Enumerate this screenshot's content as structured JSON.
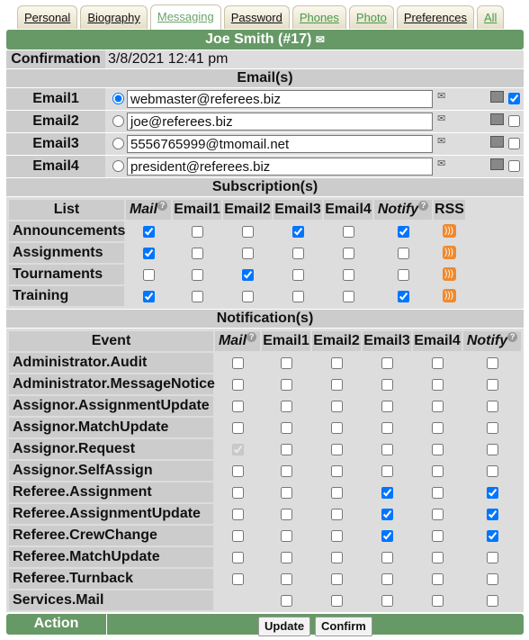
{
  "tabs": [
    {
      "label": "Personal",
      "style": "normal"
    },
    {
      "label": "Biography",
      "style": "normal"
    },
    {
      "label": "Messaging",
      "style": "active"
    },
    {
      "label": "Password",
      "style": "normal"
    },
    {
      "label": "Phones",
      "style": "green"
    },
    {
      "label": "Photo",
      "style": "green"
    },
    {
      "label": "Preferences",
      "style": "normal"
    },
    {
      "label": "All",
      "style": "green"
    }
  ],
  "header": {
    "title": "Joe Smith (#17)"
  },
  "confirmation": {
    "label": "Confirmation",
    "value": "3/8/2021 12:41 pm"
  },
  "emails_section": "Email(s)",
  "emails": [
    {
      "label": "Email1",
      "value": "webmaster@referees.biz",
      "primary": true,
      "checked": true
    },
    {
      "label": "Email2",
      "value": "joe@referees.biz",
      "primary": false,
      "checked": false
    },
    {
      "label": "Email3",
      "value": "5556765999@tmomail.net",
      "primary": false,
      "checked": false
    },
    {
      "label": "Email4",
      "value": "president@referees.biz",
      "primary": false,
      "checked": false
    }
  ],
  "subscriptions": {
    "title": "Subscription(s)",
    "columns": [
      "List",
      "Mail",
      "Email1",
      "Email2",
      "Email3",
      "Email4",
      "Notify",
      "RSS"
    ],
    "rows": [
      {
        "name": "Announcements",
        "checks": [
          true,
          false,
          false,
          true,
          false,
          true
        ]
      },
      {
        "name": "Assignments",
        "checks": [
          true,
          false,
          false,
          false,
          false,
          false
        ]
      },
      {
        "name": "Tournaments",
        "checks": [
          false,
          false,
          true,
          false,
          false,
          false
        ]
      },
      {
        "name": "Training",
        "checks": [
          true,
          false,
          false,
          false,
          false,
          true
        ]
      }
    ]
  },
  "notifications": {
    "title": "Notification(s)",
    "columns": [
      "Event",
      "Mail",
      "Email1",
      "Email2",
      "Email3",
      "Email4",
      "Notify"
    ],
    "rows": [
      {
        "name": "Administrator.Audit",
        "checks": [
          false,
          false,
          false,
          false,
          false,
          false
        ]
      },
      {
        "name": "Administrator.MessageNotice",
        "checks": [
          false,
          false,
          false,
          false,
          false,
          false
        ]
      },
      {
        "name": "Assignor.AssignmentUpdate",
        "checks": [
          false,
          false,
          false,
          false,
          false,
          false
        ]
      },
      {
        "name": "Assignor.MatchUpdate",
        "checks": [
          false,
          false,
          false,
          false,
          false,
          false
        ]
      },
      {
        "name": "Assignor.Request",
        "checks": [
          "disabled-checked",
          false,
          false,
          false,
          false,
          false
        ]
      },
      {
        "name": "Assignor.SelfAssign",
        "checks": [
          false,
          false,
          false,
          false,
          false,
          false
        ]
      },
      {
        "name": "Referee.Assignment",
        "checks": [
          false,
          false,
          false,
          true,
          false,
          true
        ]
      },
      {
        "name": "Referee.AssignmentUpdate",
        "checks": [
          false,
          false,
          false,
          true,
          false,
          true
        ]
      },
      {
        "name": "Referee.CrewChange",
        "checks": [
          false,
          false,
          false,
          true,
          false,
          true
        ]
      },
      {
        "name": "Referee.MatchUpdate",
        "checks": [
          false,
          false,
          false,
          false,
          false,
          false
        ]
      },
      {
        "name": "Referee.Turnback",
        "checks": [
          false,
          false,
          false,
          false,
          false,
          false
        ]
      },
      {
        "name": "Services.Mail",
        "checks": [
          null,
          false,
          false,
          false,
          false,
          false
        ]
      }
    ]
  },
  "action": {
    "label": "Action",
    "update": "Update",
    "confirm": "Confirm"
  },
  "colors": {
    "header": "#679966",
    "section": "#cccccc",
    "row": "#dddddd",
    "rss": "#f0892e"
  }
}
